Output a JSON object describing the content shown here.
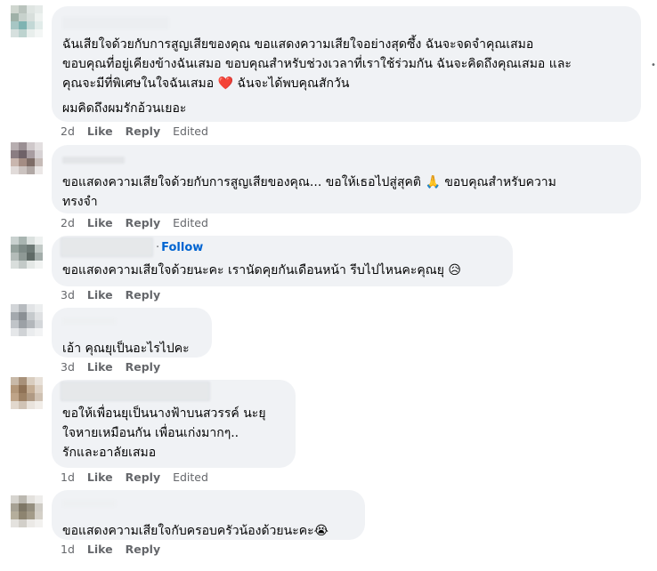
{
  "comments": [
    {
      "text": "ฉันเสียใจด้วยกับการสูญเสียของคุณ ขอแสดงความเสียใจอย่างสุดซึ้ง ฉันจะจดจำคุณเสมอ\nขอบคุณที่อยู่เคียงข้างฉันเสมอ ขอบคุณสำหรับช่วงเวลาที่เราใช้ร่วมกัน ฉันจะคิดถึงคุณเสมอ และ\nคุณจะมีที่พิเศษในใจฉันเสมอ",
      "emoji": "❤️",
      "text_after": " ฉันจะได้พบคุณสักวัน",
      "text2": "ผมคิดถึงผมรักอ้วนเยอะ",
      "time": "2d",
      "like": "Like",
      "reply": "Reply",
      "edited": "Edited"
    },
    {
      "text": "ขอแสดงความเสียใจด้วยกับการสูญเสียของคุณ... ขอให้เธอไปสู่สุคติ",
      "emoji": "🙏",
      "text_after": " ขอบคุณสำหรับความ\nทรงจำ",
      "time": "2d",
      "like": "Like",
      "reply": "Reply",
      "edited": "Edited"
    },
    {
      "follow": "Follow",
      "text": "ขอแสดงความเสียใจด้วยนะคะ เรานัดคุยกันเดือนหน้า รีบไปไหนคะคุณยุ ",
      "emoji": "😥",
      "time": "3d",
      "like": "Like",
      "reply": "Reply"
    },
    {
      "text": "เอ้า คุณยุเป็นอะไรไปคะ",
      "time": "3d",
      "like": "Like",
      "reply": "Reply"
    },
    {
      "text": "ขอให้เพื่อนยุเป็นนางฟ้าบนสวรรค์ นะยุ\nใจหายเหมือนกัน เพื่อนเก่งมากๆ..\nรักและอาลัยเสมอ",
      "time": "1d",
      "like": "Like",
      "reply": "Reply",
      "edited": "Edited"
    },
    {
      "text": "ขอแสดงความเสียใจกับครอบครัวน้องด้วยนะคะ",
      "emoji": "😭",
      "time": "1d",
      "like": "Like",
      "reply": "Reply"
    }
  ],
  "colors": {
    "bubble": "#f0f2f5",
    "meta": "#65676b",
    "link": "#0064d1"
  },
  "icons": {
    "more": "more-options-icon"
  }
}
